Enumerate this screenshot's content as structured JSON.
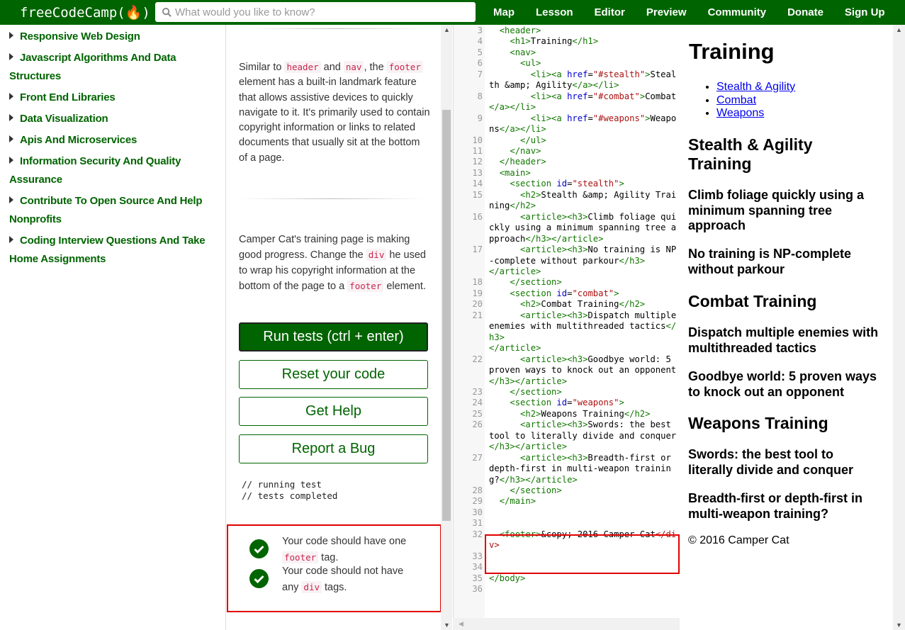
{
  "header": {
    "brand": "freeCodeCamp(🔥)",
    "search_placeholder": "What would you like to know?",
    "links": [
      "Map",
      "Lesson",
      "Editor",
      "Preview",
      "Community",
      "Donate",
      "Sign Up"
    ]
  },
  "sidebar": {
    "items": [
      "Responsive Web Design",
      "Javascript Algorithms And Data Structures",
      "Front End Libraries",
      "Data Visualization",
      "Apis And Microservices",
      "Information Security And Quality Assurance",
      "Contribute To Open Source And Help Nonprofits",
      "Coding Interview Questions And Take Home Assignments"
    ]
  },
  "instructions": {
    "p1": {
      "pre": "Similar to ",
      "c1": "header",
      "mid1": " and ",
      "c2": "nav",
      "mid2": ", the ",
      "c3": "footer",
      "post": " element has a built-in landmark feature that allows assistive devices to quickly navigate to it. It's primarily used to contain copyright information or links to related documents that usually sit at the bottom of a page."
    },
    "p2": {
      "pre": "Camper Cat's training page is making good progress. Change the ",
      "c1": "div",
      "mid": " he used to wrap his copyright information at the bottom of the page to a ",
      "c2": "footer",
      "post": " element."
    },
    "buttons": {
      "run": "Run tests (ctrl + enter)",
      "reset": "Reset your code",
      "help": "Get Help",
      "bug": "Report a Bug"
    },
    "console": [
      "// running test",
      "// tests completed"
    ],
    "tests": [
      {
        "pre": "Your code should have one ",
        "code": "footer",
        "post": " tag."
      },
      {
        "pre": "Your code should not have any ",
        "code": "div",
        "post": " tags."
      }
    ]
  },
  "editor": {
    "lines": [
      {
        "n": "3",
        "h": "  <span class='tg'>&lt;header&gt;</span>"
      },
      {
        "n": "4",
        "h": "    <span class='tg'>&lt;h1&gt;</span>Training<span class='tg'>&lt;/h1&gt;</span>"
      },
      {
        "n": "5",
        "h": "    <span class='tg'>&lt;nav&gt;</span>"
      },
      {
        "n": "6",
        "h": "      <span class='tg'>&lt;ul&gt;</span>"
      },
      {
        "n": "7",
        "h": "        <span class='tg'>&lt;li&gt;&lt;a</span> <span class='at'>href</span>=<span class='st'>\"#stealth\"</span><span class='tg'>&gt;</span>Stealth &amp;amp; Agility<span class='tg'>&lt;/a&gt;&lt;/li&gt;</span>"
      },
      {
        "n": "8",
        "h": "        <span class='tg'>&lt;li&gt;&lt;a</span> <span class='at'>href</span>=<span class='st'>\"#combat\"</span><span class='tg'>&gt;</span>Combat<span class='tg'>&lt;/a&gt;&lt;/li&gt;</span>"
      },
      {
        "n": "9",
        "h": "        <span class='tg'>&lt;li&gt;&lt;a</span> <span class='at'>href</span>=<span class='st'>\"#weapons\"</span><span class='tg'>&gt;</span>Weapons<span class='tg'>&lt;/a&gt;&lt;/li&gt;</span>"
      },
      {
        "n": "10",
        "h": "      <span class='tg'>&lt;/ul&gt;</span>"
      },
      {
        "n": "11",
        "h": "    <span class='tg'>&lt;/nav&gt;</span>"
      },
      {
        "n": "12",
        "h": "  <span class='tg'>&lt;/header&gt;</span>"
      },
      {
        "n": "13",
        "h": "  <span class='tg'>&lt;main&gt;</span>"
      },
      {
        "n": "14",
        "h": "    <span class='tg'>&lt;section</span> <span class='at'>id</span>=<span class='st'>\"stealth\"</span><span class='tg'>&gt;</span>"
      },
      {
        "n": "15",
        "h": "      <span class='tg'>&lt;h2&gt;</span>Stealth &amp;amp; Agility Training<span class='tg'>&lt;/h2&gt;</span>"
      },
      {
        "n": "16",
        "h": "      <span class='tg'>&lt;article&gt;&lt;h3&gt;</span>Climb foliage quickly using a minimum spanning tree approach<span class='tg'>&lt;/h3&gt;&lt;/article&gt;</span>"
      },
      {
        "n": "17",
        "h": "      <span class='tg'>&lt;article&gt;&lt;h3&gt;</span>No training is NP-complete without parkour<span class='tg'>&lt;/h3&gt;</span>\n<span class='tg'>&lt;/article&gt;</span>"
      },
      {
        "n": "18",
        "h": "    <span class='tg'>&lt;/section&gt;</span>"
      },
      {
        "n": "19",
        "h": "    <span class='tg'>&lt;section</span> <span class='at'>id</span>=<span class='st'>\"combat\"</span><span class='tg'>&gt;</span>"
      },
      {
        "n": "20",
        "h": "      <span class='tg'>&lt;h2&gt;</span>Combat Training<span class='tg'>&lt;/h2&gt;</span>"
      },
      {
        "n": "21",
        "h": "      <span class='tg'>&lt;article&gt;&lt;h3&gt;</span>Dispatch multiple enemies with multithreaded tactics<span class='tg'>&lt;/h3&gt;</span>\n<span class='tg'>&lt;/article&gt;</span>"
      },
      {
        "n": "22",
        "h": "      <span class='tg'>&lt;article&gt;&lt;h3&gt;</span>Goodbye world: 5 proven ways to knock out an opponent<span class='tg'>&lt;/h3&gt;&lt;/article&gt;</span>"
      },
      {
        "n": "23",
        "h": "    <span class='tg'>&lt;/section&gt;</span>"
      },
      {
        "n": "24",
        "h": "    <span class='tg'>&lt;section</span> <span class='at'>id</span>=<span class='st'>\"weapons\"</span><span class='tg'>&gt;</span>"
      },
      {
        "n": "25",
        "h": "      <span class='tg'>&lt;h2&gt;</span>Weapons Training<span class='tg'>&lt;/h2&gt;</span>"
      },
      {
        "n": "26",
        "h": "      <span class='tg'>&lt;article&gt;&lt;h3&gt;</span>Swords: the best tool to literally divide and conquer<span class='tg'>&lt;/h3&gt;&lt;/article&gt;</span>"
      },
      {
        "n": "27",
        "h": "      <span class='tg'>&lt;article&gt;&lt;h3&gt;</span>Breadth-first or depth-first in multi-weapon training?<span class='tg'>&lt;/h3&gt;&lt;/article&gt;</span>"
      },
      {
        "n": "28",
        "h": "    <span class='tg'>&lt;/section&gt;</span>"
      },
      {
        "n": "29",
        "h": "  <span class='tg'>&lt;/main&gt;</span>"
      },
      {
        "n": "30",
        "h": " "
      },
      {
        "n": "31",
        "h": " "
      },
      {
        "n": "32",
        "h": "  <span class='tg'>&lt;footer&gt;</span>&amp;copy; 2016 Camper Cat<span class='st'>&lt;/div&gt;</span>"
      },
      {
        "n": "33",
        "h": " "
      },
      {
        "n": "34",
        "h": " "
      },
      {
        "n": "35",
        "h": "<span class='tg'>&lt;/body&gt;</span>"
      },
      {
        "n": "36",
        "h": " "
      }
    ]
  },
  "preview": {
    "h1": "Training",
    "nav": [
      "Stealth & Agility",
      "Combat",
      "Weapons"
    ],
    "sections": [
      {
        "h2": "Stealth & Agility Training",
        "h3": [
          "Climb foliage quickly using a minimum spanning tree approach",
          "No training is NP-complete without parkour"
        ]
      },
      {
        "h2": "Combat Training",
        "h3": [
          "Dispatch multiple enemies with multithreaded tactics",
          "Goodbye world: 5 proven ways to knock out an opponent"
        ]
      },
      {
        "h2": "Weapons Training",
        "h3": [
          "Swords: the best tool to literally divide and conquer",
          "Breadth-first or depth-first in multi-weapon training?"
        ]
      }
    ],
    "footer": "© 2016 Camper Cat"
  }
}
